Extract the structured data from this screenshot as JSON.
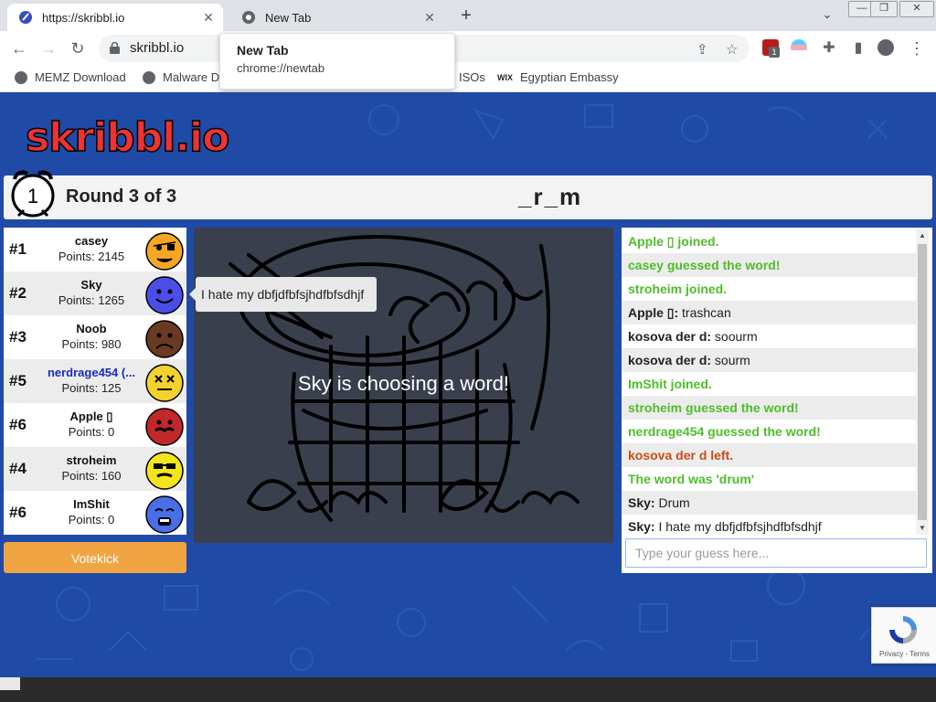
{
  "browser": {
    "tabs": [
      {
        "title": "https://skribbl.io",
        "active": true
      },
      {
        "title": "New Tab",
        "active": false
      }
    ],
    "hover_tooltip": {
      "title": "New Tab",
      "url": "chrome://newtab"
    },
    "address": "skribbl.io",
    "extension_badge": "1",
    "bookmarks": [
      {
        "label": "MEMZ Download"
      },
      {
        "label": "Malware D"
      },
      {
        "label": "ISOs"
      },
      {
        "label": "Egyptian Embassy",
        "icon_text": "WIX"
      }
    ]
  },
  "game": {
    "logo": "skribbl.io",
    "timer": "1",
    "round": "Round 3 of 3",
    "word": "_r_m",
    "canvas_overlay": "Sky is choosing a word!",
    "speech_bubble": "I hate my dbfjdfbfsjhdfbfsdhjf",
    "votekick": "Votekick",
    "players": [
      {
        "rank": "#1",
        "name": "casey",
        "points": "Points: 2145",
        "color": "#f5a623",
        "face": "eyepatch"
      },
      {
        "rank": "#2",
        "name": "Sky",
        "points": "Points: 1265",
        "color": "#4a4ee6",
        "face": "happy"
      },
      {
        "rank": "#3",
        "name": "Noob",
        "points": "Points: 980",
        "color": "#6b3a22",
        "face": "sad"
      },
      {
        "rank": "#5",
        "name": "nerdrage454 (...",
        "points": "Points: 125",
        "color": "#f2d22e",
        "face": "dead",
        "is_you": true
      },
      {
        "rank": "#6",
        "name": "Apple ▯",
        "points": "Points: 0",
        "color": "#c0282a",
        "face": "stache"
      },
      {
        "rank": "#4",
        "name": "stroheim",
        "points": "Points: 160",
        "color": "#f4e41c",
        "face": "cool"
      },
      {
        "rank": "#6",
        "name": "ImShit",
        "points": "Points: 0",
        "color": "#4a6ee6",
        "face": "scream"
      }
    ],
    "chat": [
      {
        "text": "Apple ▯ joined.",
        "style": "green"
      },
      {
        "text": "casey guessed the word!",
        "style": "green"
      },
      {
        "text": "stroheim joined.",
        "style": "green"
      },
      {
        "who": "Apple ▯:",
        "text": " trashcan",
        "style": "normal"
      },
      {
        "who": "kosova der d:",
        "text": " soourm",
        "style": "normal"
      },
      {
        "who": "kosova der d:",
        "text": " sourm",
        "style": "normal"
      },
      {
        "text": "ImShit joined.",
        "style": "green"
      },
      {
        "text": "stroheim guessed the word!",
        "style": "green"
      },
      {
        "text": "nerdrage454 guessed the word!",
        "style": "green"
      },
      {
        "text": "kosova der d left.",
        "style": "orange"
      },
      {
        "text": "The word was 'drum'",
        "style": "green"
      },
      {
        "who": "Sky:",
        "text": " Drum",
        "style": "normal"
      },
      {
        "who": "Sky:",
        "text": " I hate my dbfjdfbfsjhdfbfsdhjf",
        "style": "normal"
      }
    ],
    "guess_placeholder": "Type your guess here...",
    "recaptcha": "Privacy - Terms"
  },
  "colors": {
    "page_bg": "#1f4ba6",
    "chat_green": "#4fbd2a",
    "chat_orange": "#ce4c14",
    "votekick": "#f0a542",
    "canvas_bg": "#3a3f4d"
  }
}
